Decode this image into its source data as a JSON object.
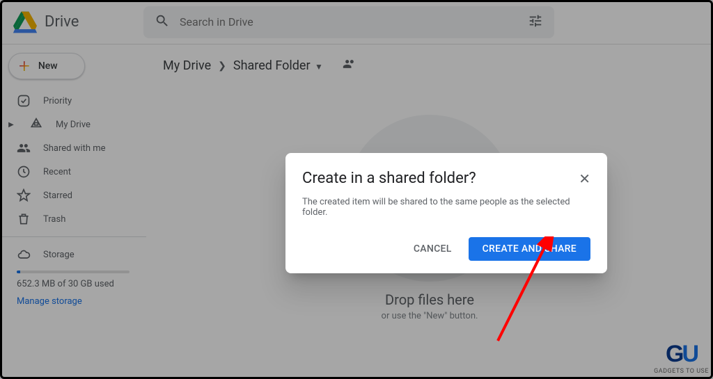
{
  "header": {
    "app_name": "Drive",
    "search_placeholder": "Search in Drive"
  },
  "sidebar": {
    "new_label": "New",
    "items": [
      {
        "label": "Priority",
        "icon": "priority"
      },
      {
        "label": "My Drive",
        "icon": "mydrive"
      },
      {
        "label": "Shared with me",
        "icon": "shared"
      },
      {
        "label": "Recent",
        "icon": "recent"
      },
      {
        "label": "Starred",
        "icon": "starred"
      },
      {
        "label": "Trash",
        "icon": "trash"
      }
    ],
    "storage_label": "Storage",
    "storage_used_text": "652.3 MB of 30 GB used",
    "manage_label": "Manage storage"
  },
  "breadcrumb": {
    "root": "My Drive",
    "current": "Shared Folder"
  },
  "dropzone": {
    "title": "Drop files here",
    "subtitle": "or use the \"New\" button."
  },
  "dialog": {
    "title": "Create in a shared folder?",
    "body": "The created item will be shared to the same people as the selected folder.",
    "cancel_label": "CANCEL",
    "confirm_label": "CREATE AND SHARE"
  },
  "watermark": {
    "text": "GADGETS TO USE"
  }
}
